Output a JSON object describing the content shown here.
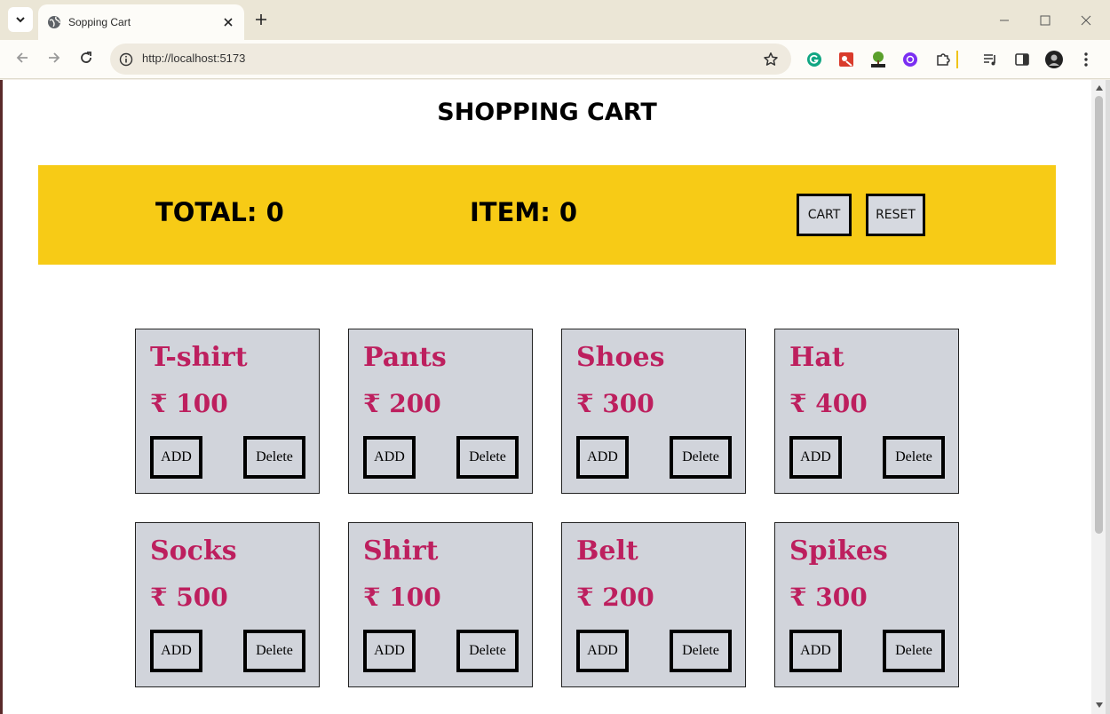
{
  "browser": {
    "tab_title": "Sopping Cart",
    "url": "http://localhost:5173",
    "icons": {
      "tab_menu": "chevron-down-icon",
      "favicon": "globe-icon",
      "tab_close": "close-icon",
      "new_tab": "plus-icon",
      "back": "arrow-left-icon",
      "forward": "arrow-right-icon",
      "reload": "reload-icon",
      "site_info": "info-icon",
      "bookmark": "star-icon",
      "extensions": [
        "grammarly-icon",
        "extension-red-icon",
        "html-extension-icon",
        "extension-purple-icon",
        "puzzle-icon",
        "media-icon",
        "sidepanel-icon",
        "profile-icon",
        "more-vertical-icon"
      ]
    },
    "colors": {
      "tab_strip": "#ebe6d6",
      "toolbar": "#fdfcf8",
      "omnibox": "#efeadf"
    }
  },
  "page": {
    "title": "SHOPPING CART",
    "banner": {
      "total_label": "TOTAL: 0",
      "item_label": "ITEM: 0",
      "cart_button": "CART",
      "reset_button": "RESET",
      "color": "#f7cb16"
    },
    "products": [
      {
        "name": "T-shirt",
        "price": "₹ 100",
        "add_label": "ADD",
        "delete_label": "Delete"
      },
      {
        "name": "Pants",
        "price": "₹ 200",
        "add_label": "ADD",
        "delete_label": "Delete"
      },
      {
        "name": "Shoes",
        "price": "₹ 300",
        "add_label": "ADD",
        "delete_label": "Delete"
      },
      {
        "name": "Hat",
        "price": "₹ 400",
        "add_label": "ADD",
        "delete_label": "Delete"
      },
      {
        "name": "Socks",
        "price": "₹ 500",
        "add_label": "ADD",
        "delete_label": "Delete"
      },
      {
        "name": "Shirt",
        "price": "₹ 100",
        "add_label": "ADD",
        "delete_label": "Delete"
      },
      {
        "name": "Belt",
        "price": "₹ 200",
        "add_label": "ADD",
        "delete_label": "Delete"
      },
      {
        "name": "Spikes",
        "price": "₹ 300",
        "add_label": "ADD",
        "delete_label": "Delete"
      }
    ],
    "colors": {
      "card_bg": "#d1d4db",
      "product_text": "#bd1f5e"
    }
  }
}
